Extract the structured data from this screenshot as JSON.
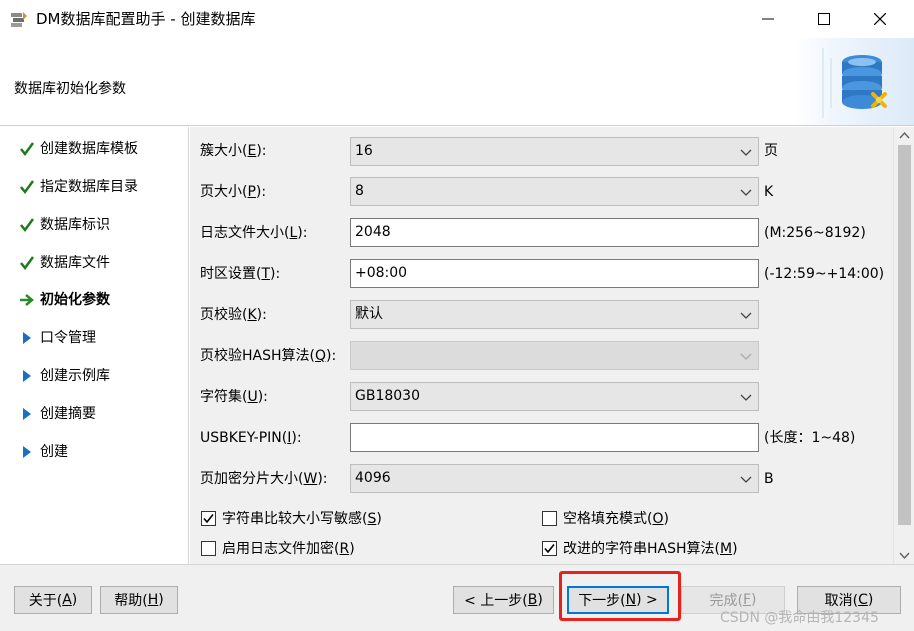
{
  "window": {
    "title": "DM数据库配置助手 - 创建数据库",
    "app_icon": "dm-installer-icon"
  },
  "header": {
    "title": "数据库初始化参数",
    "art": "database-config-icon"
  },
  "sidebar": {
    "steps": [
      {
        "label": "创建数据库模板",
        "state": "done"
      },
      {
        "label": "指定数据库目录",
        "state": "done"
      },
      {
        "label": "数据库标识",
        "state": "done"
      },
      {
        "label": "数据库文件",
        "state": "done"
      },
      {
        "label": "初始化参数",
        "state": "current"
      },
      {
        "label": "口令管理",
        "state": "pending"
      },
      {
        "label": "创建示例库",
        "state": "pending"
      },
      {
        "label": "创建摘要",
        "state": "pending"
      },
      {
        "label": "创建",
        "state": "pending"
      }
    ]
  },
  "form": {
    "extent_size": {
      "label_pre": "簇大小(",
      "key": "E",
      "label_post": "):",
      "value": "16",
      "suffix": "页"
    },
    "page_size": {
      "label_pre": "页大小(",
      "key": "P",
      "label_post": "):",
      "value": "8",
      "suffix": "K"
    },
    "log_size": {
      "label_pre": "日志文件大小(",
      "key": "L",
      "label_post": "):",
      "value": "2048",
      "suffix": "(M:256~8192)"
    },
    "timezone": {
      "label_pre": "时区设置(",
      "key": "T",
      "label_post": "):",
      "value": "+08:00",
      "suffix": "(-12:59~+14:00)"
    },
    "page_check": {
      "label_pre": "页校验(",
      "key": "K",
      "label_post": "):",
      "value": "默认"
    },
    "page_check_hash": {
      "label_pre": "页校验HASH算法(",
      "key": "Q",
      "label_post": "):",
      "value": ""
    },
    "charset": {
      "label_pre": "字符集(",
      "key": "U",
      "label_post": "):",
      "value": "GB18030"
    },
    "usbkey_pin": {
      "label_pre": "USBKEY-PIN(",
      "key": "I",
      "label_post": "):",
      "value": "",
      "suffix": "(长度：1~48)"
    },
    "page_encrypt_size": {
      "label_pre": "页加密分片大小(",
      "key": "W",
      "label_post": "):",
      "value": "4096",
      "suffix": "B"
    },
    "checkboxes": [
      {
        "label_pre": "字符串比较大小写敏感(",
        "key": "S",
        "label_post": ")",
        "checked": true
      },
      {
        "label_pre": "空格填充模式(",
        "key": "O",
        "label_post": ")",
        "checked": false
      },
      {
        "label_pre": "启用日志文件加密(",
        "key": "R",
        "label_post": ")",
        "checked": false
      },
      {
        "label_pre": "改进的字符串HASH算法(",
        "key": "M",
        "label_post": ")",
        "checked": true
      }
    ]
  },
  "footer": {
    "about": {
      "label_pre": "关于(",
      "key": "A",
      "label_post": ")"
    },
    "help": {
      "label_pre": "帮助(",
      "key": "H",
      "label_post": ")"
    },
    "prev": {
      "label_pre": "< 上一步(",
      "key": "B",
      "label_post": ")"
    },
    "next": {
      "label_pre": "下一步(",
      "key": "N",
      "label_post": ") >"
    },
    "finish": {
      "label_pre": "完成(",
      "key": "F",
      "label_post": ")"
    },
    "cancel": {
      "label_pre": "取消(",
      "key": "C",
      "label_post": ")"
    }
  },
  "watermark": "CSDN @我命由我12345",
  "colors": {
    "check": "#1e7a1e",
    "arrow": "#2a8a2a",
    "pending": "#1a6fc4",
    "highlight": "#e8231d",
    "focus": "#0078d7"
  }
}
